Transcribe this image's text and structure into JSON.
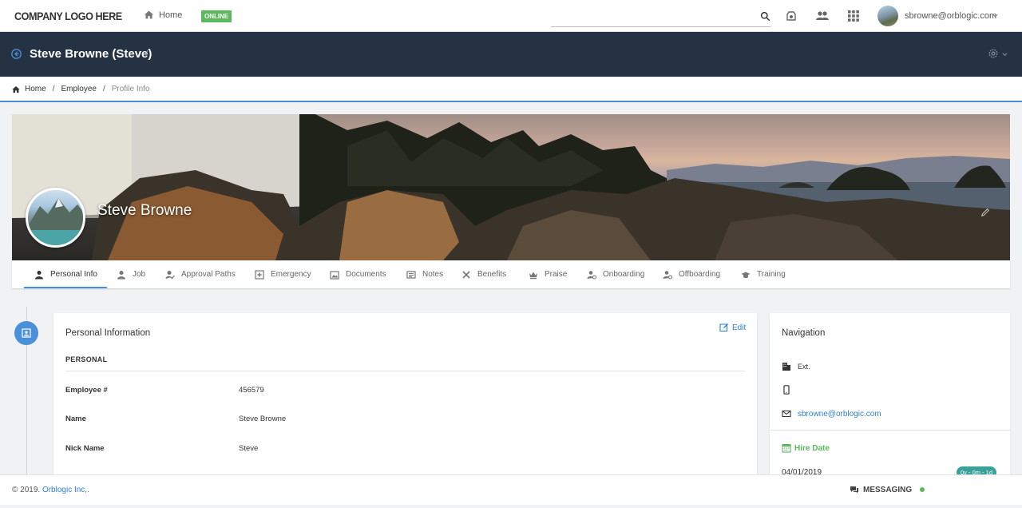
{
  "topbar": {
    "logo": "COMPANY LOGO HERE",
    "home_label": "Home",
    "status_badge": "ONLINE",
    "search_placeholder": "",
    "user_email": "sbrowne@orblogic.com"
  },
  "header": {
    "title": "Steve Browne (Steve)",
    "separator": "/"
  },
  "breadcrumb": {
    "items": [
      "Home",
      "Employee",
      "Profile Info"
    ],
    "separator": "/"
  },
  "profile": {
    "name": "Steve Browne"
  },
  "tabs": [
    {
      "label": "Personal Info",
      "icon": "person-icon",
      "active": true
    },
    {
      "label": "Job",
      "icon": "person-icon"
    },
    {
      "label": "Approval Paths",
      "icon": "approval-icon"
    },
    {
      "label": "Emergency",
      "icon": "emergency-icon"
    },
    {
      "label": "Documents",
      "icon": "documents-icon"
    },
    {
      "label": "Notes",
      "icon": "notes-icon"
    },
    {
      "label": "Benefits",
      "icon": "benefits-icon"
    },
    {
      "label": "Praise",
      "icon": "crown-icon"
    },
    {
      "label": "Onboarding",
      "icon": "onboarding-icon"
    },
    {
      "label": "Offboarding",
      "icon": "offboarding-icon"
    },
    {
      "label": "Training",
      "icon": "graduation-cap-icon"
    }
  ],
  "personal_card": {
    "title": "Personal Information",
    "edit_label": "Edit",
    "section": "PERSONAL",
    "fields": [
      {
        "label": "Employee #",
        "value": "456579"
      },
      {
        "label": "Name",
        "value": "Steve Browne"
      },
      {
        "label": "Nick Name",
        "value": "Steve"
      }
    ]
  },
  "navigation_card": {
    "title": "Navigation",
    "ext_label": "Ext.",
    "email": "sbrowne@orblogic.com",
    "hire_title": "Hire Date",
    "hire_date": "04/01/2019",
    "tenure": "0y - 0m - 1d"
  },
  "footer": {
    "copyright_prefix": "© 2019.",
    "company_link": "Orblogic Inc,.",
    "messaging_label": "MESSAGING"
  },
  "colors": {
    "accent": "#4a90d9",
    "header_bg": "#243243",
    "online_green": "#5cb85c",
    "link_blue": "#2f80d1",
    "tenure_teal": "#3aa19a"
  }
}
